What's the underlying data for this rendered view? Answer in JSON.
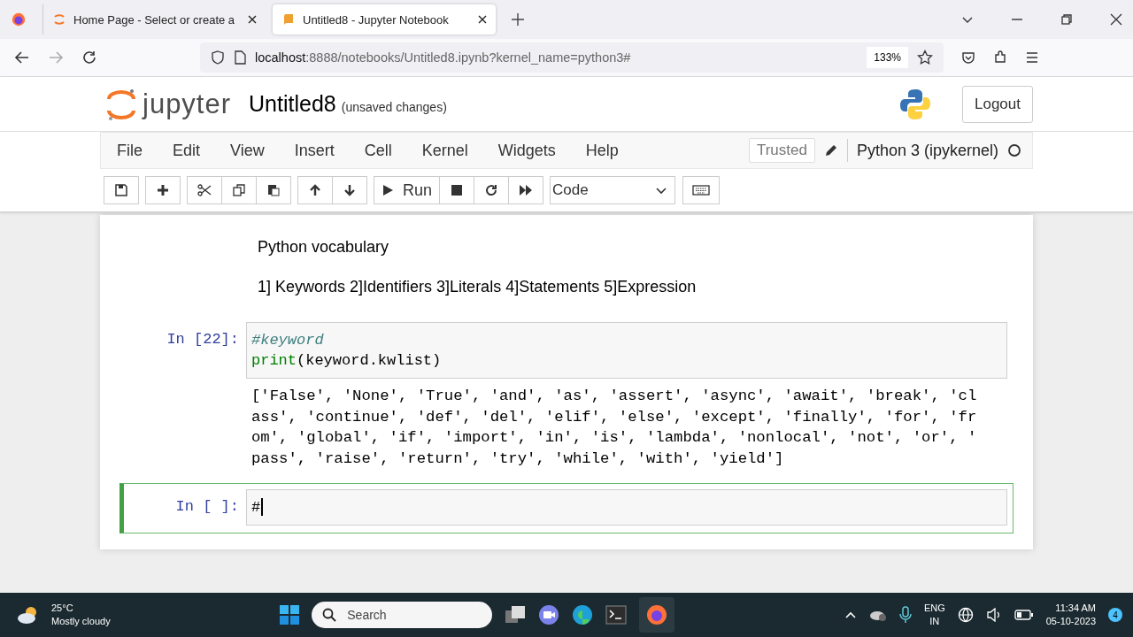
{
  "browser": {
    "tabs": [
      {
        "title": "Home Page - Select or create a",
        "selected": false
      },
      {
        "title": "Untitled8 - Jupyter Notebook",
        "selected": true
      }
    ],
    "url": {
      "host": "localhost",
      "rest": ":8888/notebooks/Untitled8.ipynb?kernel_name=python3#"
    },
    "zoom": "133%"
  },
  "header": {
    "logo": "jupyter",
    "title": "Untitled8",
    "status": "(unsaved changes)",
    "logout": "Logout"
  },
  "menu": {
    "items": [
      "File",
      "Edit",
      "View",
      "Insert",
      "Cell",
      "Kernel",
      "Widgets",
      "Help"
    ],
    "trusted": "Trusted",
    "kernel": "Python 3 (ipykernel)"
  },
  "toolbar": {
    "run": "Run",
    "cell_type": "Code"
  },
  "cells": [
    {
      "kind": "markdown",
      "paragraphs": [
        "Python vocabulary",
        "1] Keywords 2]Identifiers 3]Literals 4]Statements 5]Expression"
      ]
    },
    {
      "kind": "code",
      "selected": false,
      "prompt": "In [22]:",
      "lines": [
        [
          {
            "kind": "comment",
            "text": "#keyword"
          }
        ],
        [
          {
            "kind": "builtin",
            "text": "print"
          },
          {
            "kind": "plain",
            "text": "(keyword.kwlist)"
          }
        ]
      ],
      "output": [
        "['False', 'None', 'True', 'and', 'as', 'assert', 'async', 'await', 'break', 'cl",
        "ass', 'continue', 'def', 'del', 'elif', 'else', 'except', 'finally', 'for', 'fr",
        "om', 'global', 'if', 'import', 'in', 'is', 'lambda', 'nonlocal', 'not', 'or', '",
        "pass', 'raise', 'return', 'try', 'while', 'with', 'yield']"
      ]
    },
    {
      "kind": "code",
      "selected": true,
      "prompt": "In [ ]:",
      "lines": [
        [
          {
            "kind": "plain",
            "text": "#"
          }
        ]
      ]
    }
  ],
  "taskbar": {
    "temperature": "25°C",
    "weather": "Mostly cloudy",
    "search": "Search",
    "language": "ENG",
    "region": "IN",
    "time": "11:34 AM",
    "date": "05-10-2023",
    "notifications": "4"
  }
}
